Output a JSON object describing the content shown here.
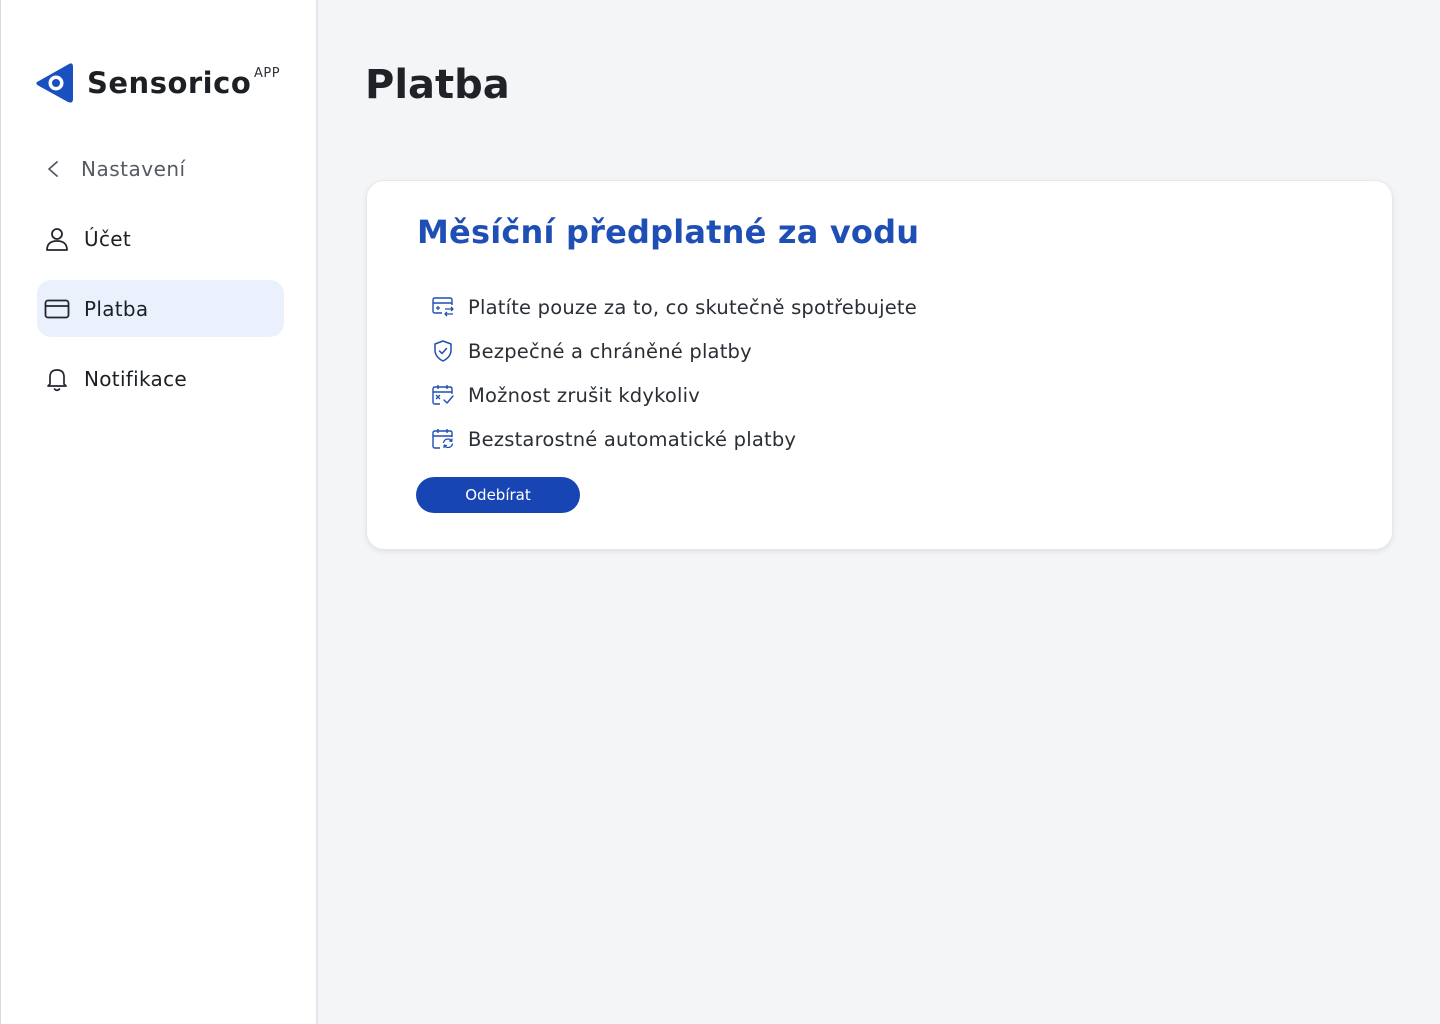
{
  "brand": {
    "name": "Sensorico",
    "suffix": "APP",
    "color": "#1a4fc0"
  },
  "sidebar": {
    "back_label": "Nastavení",
    "items": [
      {
        "label": "Účet",
        "icon": "user-icon",
        "active": false
      },
      {
        "label": "Platba",
        "icon": "credit-card-icon",
        "active": true
      },
      {
        "label": "Notifikace",
        "icon": "bell-icon",
        "active": false
      }
    ]
  },
  "main": {
    "title": "Platba"
  },
  "card": {
    "title": "Měsíční předplatné za vodu",
    "features": [
      {
        "label": "Platíte pouze za to, co skutečně spotřebujete",
        "icon": "usage-icon"
      },
      {
        "label": "Bezpečné a chráněné platby",
        "icon": "shield-check-icon"
      },
      {
        "label": "Možnost zrušit kdykoliv",
        "icon": "calendar-cancel-icon"
      },
      {
        "label": "Bezstarostné automatické platby",
        "icon": "calendar-refresh-icon"
      }
    ],
    "button_label": "Odebírat"
  },
  "colors": {
    "accent": "#1746b4",
    "title_blue": "#1f4fb5",
    "active_nav_bg": "#eaf1fd",
    "page_bg": "#f4f5f7"
  }
}
